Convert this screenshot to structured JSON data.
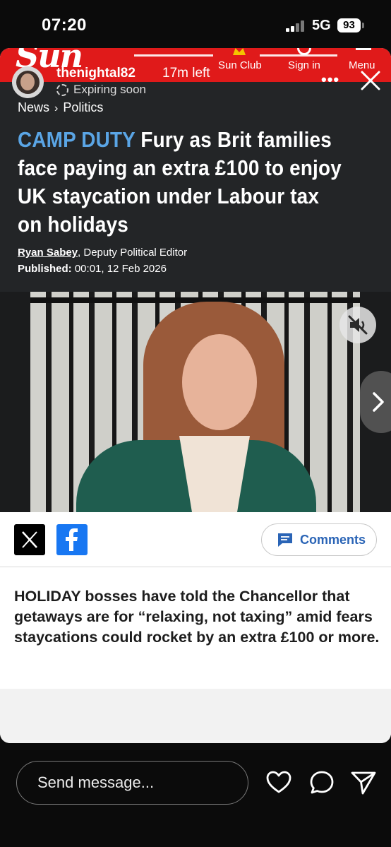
{
  "status_bar": {
    "time": "07:20",
    "network": "5G",
    "battery": "93"
  },
  "story": {
    "username": "thenightal82",
    "time_left": "17m left",
    "expiring": "Expiring soon"
  },
  "site": {
    "logo": "Sun",
    "nav": [
      "Sun Club",
      "Sign in",
      "Menu"
    ]
  },
  "article": {
    "breadcrumb": [
      "News",
      "Politics"
    ],
    "kicker": "CAMP DUTY",
    "headline": "Fury as Brit families face paying an extra £100 to enjoy UK staycation under Labour tax on holidays",
    "author": "Ryan Sabey",
    "author_role": ", Deputy Political Editor",
    "published_label": "Published:",
    "published_value": " 00:01, 12 Feb 2026",
    "comments_label": "Comments",
    "lede_strong": "HOLIDAY",
    "lede_rest": " bosses have told the Chancellor that getaways are for “relaxing, not taxing” amid fears staycations could rocket by an extra £100 or more."
  },
  "reply": {
    "placeholder": "Send message..."
  },
  "colors": {
    "sun_red": "#e01a1a",
    "kicker_blue": "#5aa5e5",
    "facebook_blue": "#1877f2",
    "comments_blue": "#2a64b6"
  },
  "icons": [
    "close-icon",
    "more-icon",
    "mute-icon",
    "next-icon",
    "x-logo-icon",
    "facebook-logo-icon",
    "comment-icon",
    "heart-icon",
    "comment-bubble-icon",
    "send-icon"
  ]
}
